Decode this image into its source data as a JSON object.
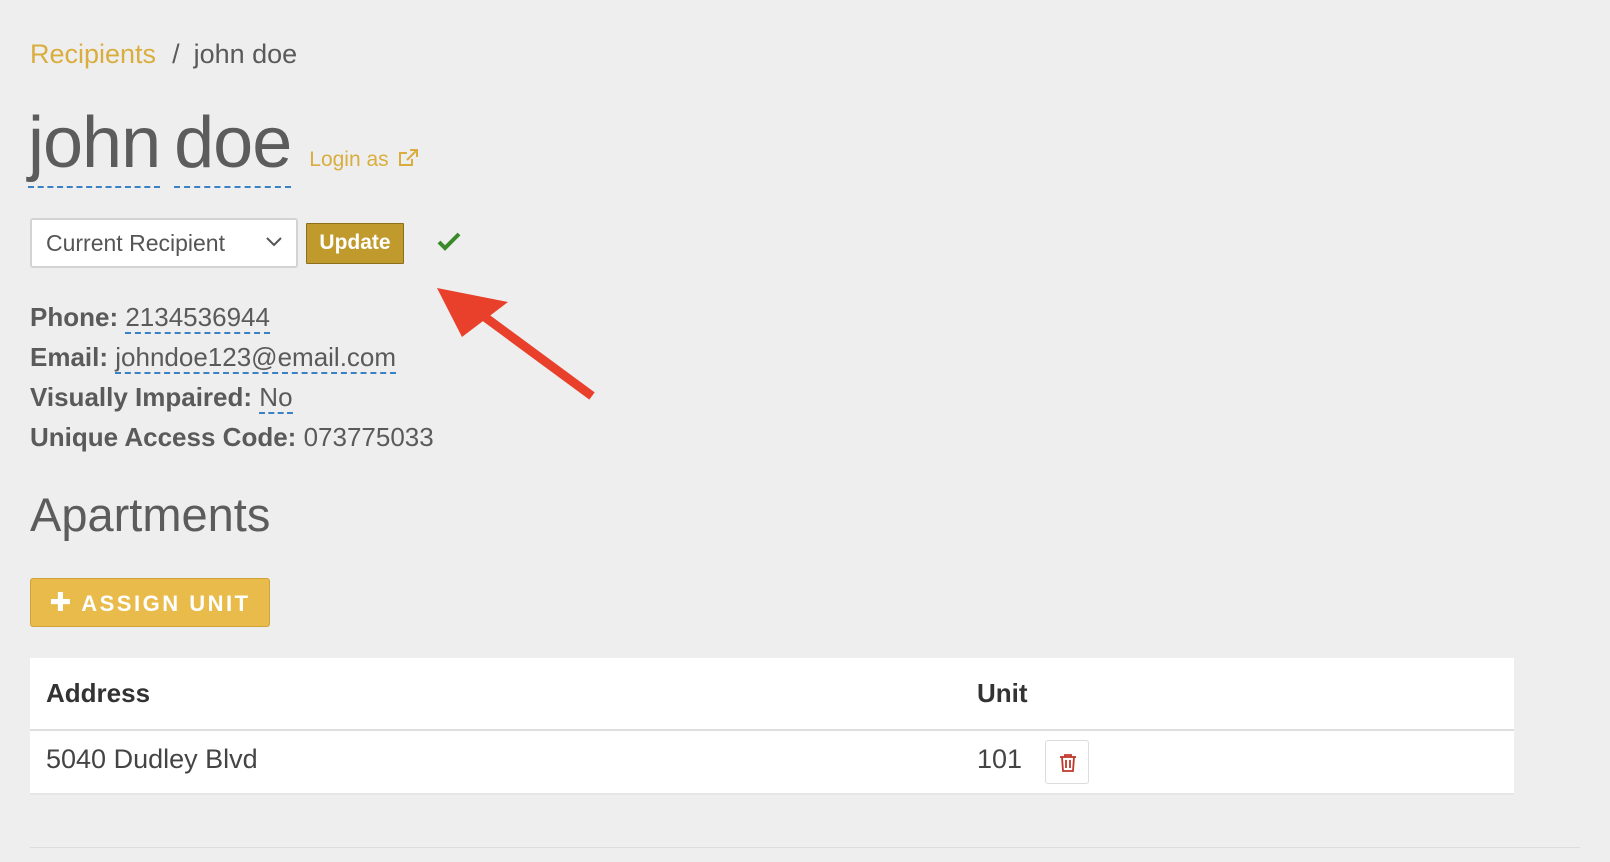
{
  "breadcrumb": {
    "parent": "Recipients",
    "separator": "/",
    "current": "john doe"
  },
  "title": {
    "first": "john",
    "last": "doe",
    "login_link": "Login as"
  },
  "status": {
    "selected": "Current Recipient",
    "update_label": "Update"
  },
  "details": {
    "phone_label": "Phone:",
    "phone": "2134536944",
    "email_label": "Email:",
    "email": "johndoe123@email.com",
    "impaired_label": "Visually Impaired:",
    "impaired": "No",
    "access_label": "Unique Access Code:",
    "access_code": "073775033"
  },
  "apartments": {
    "title": "Apartments",
    "assign_label": "ASSIGN UNIT",
    "columns": [
      "Address",
      "Unit"
    ],
    "rows": [
      {
        "address": "5040 Dudley Blvd",
        "unit": "101"
      }
    ]
  },
  "colors": {
    "link": "#d9ae3f",
    "update_button": "#c19a2d",
    "assign_button": "#e8bb4a",
    "success": "#3a8a2a",
    "annotation": "#e8402a",
    "delete": "#c0392b"
  },
  "icons": {
    "login_as": "external-link-icon",
    "status_ok": "check-icon",
    "select": "chevron-down-icon",
    "assign": "plus-icon",
    "delete": "trash-icon"
  }
}
